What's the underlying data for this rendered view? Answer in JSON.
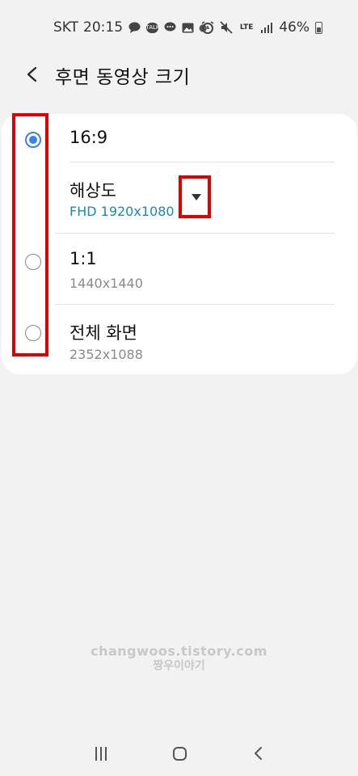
{
  "status_bar": {
    "carrier": "SKT",
    "time": "20:15",
    "talk_badge": "TALK",
    "lte": "LTE",
    "battery": "46%"
  },
  "header": {
    "title": "후면 동영상 크기"
  },
  "options": [
    {
      "label": "16:9",
      "selected": true
    },
    {
      "label": "해상도",
      "sub": "FHD 1920x1080",
      "selected": false
    },
    {
      "label": "1:1",
      "sub": "1440x1440",
      "selected": false
    },
    {
      "label": "전체 화면",
      "sub": "2352x1088",
      "selected": false
    }
  ],
  "watermark": {
    "line1": "changwoos.tistory.com",
    "line2": "짱우이야기"
  },
  "colors": {
    "accent": "#3a82e8",
    "sub_accent": "#1c88b8",
    "annotation": "#e00000"
  }
}
